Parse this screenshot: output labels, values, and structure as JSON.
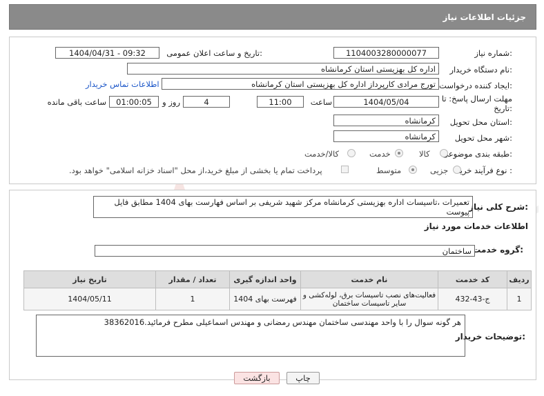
{
  "header": {
    "title": "جزئیات اطلاعات نیاز"
  },
  "form": {
    "need_number_label": "شماره نیاز:",
    "need_number": "1104003280000077",
    "announce_label": "تاریخ و ساعت اعلان عمومی:",
    "announce_value": "1404/04/31 - 09:32",
    "buyer_label": "نام دستگاه خریدار:",
    "buyer_value": "اداره کل بهزیستی استان کرمانشاه",
    "creator_label": "ایجاد کننده درخواست:",
    "creator_value": "تورج مرادی کارپرداز  اداره کل بهزیستی استان کرمانشاه",
    "contact_link": "اطلاعات تماس خریدار",
    "deadline_label_1": "مهلت ارسال پاسخ: تا",
    "deadline_label_2": "تاریخ:",
    "deadline_date": "1404/05/04",
    "time_label": "ساعت",
    "deadline_time": "11:00",
    "days_value": "4",
    "days_label": "روز و",
    "remaining_value": "01:00:05",
    "remaining_label": "ساعت باقی مانده",
    "province_label": "استان محل تحویل:",
    "province_value": "کرمانشاه",
    "city_label": "شهر محل تحویل:",
    "city_value": "کرمانشاه",
    "category_label": "طبقه بندی موضوعی:",
    "category_options": [
      "کالا",
      "خدمت",
      "کالا/خدمت"
    ],
    "category_selected": "خدمت",
    "process_label": "نوع فرآیند خرید :",
    "process_options": [
      "جزیی",
      "متوسط"
    ],
    "process_selected": "متوسط",
    "payment_note": "پرداخت تمام یا بخشی از مبلغ خرید،از محل \"اسناد خزانه اسلامی\" خواهد بود."
  },
  "description": {
    "label": "شرح کلی نیاز:",
    "value": "تعمیرات ،تاسیسات اداره بهزیستی کرمانشاه مرکز شهید شریفی  بر اساس فهارست بهای 1404 مطابق فایل پیوست"
  },
  "services": {
    "section_title": "اطلاعات خدمات مورد نیاز",
    "group_label": "گروه خدمت:",
    "group_value": "ساختمان",
    "columns": [
      "ردیف",
      "کد خدمت",
      "نام خدمت",
      "واحد اندازه گیری",
      "تعداد / مقدار",
      "تاریخ نیاز"
    ],
    "rows": [
      [
        "1",
        "ج-43-432",
        "فعالیت‌های نصب تاسیسات برق، لوله‌کشی و سایر تاسیسات ساختمان",
        "فهرست بهای 1404",
        "1",
        "1404/05/11"
      ]
    ]
  },
  "buyer_notes": {
    "label": "توضیحات خریدار:",
    "value": "هر گونه سوال را با واحد مهندسی ساختمان مهندس رمضانی و مهندس اسماعیلی مطرح فرمائید.38362016"
  },
  "buttons": {
    "print": "چاپ",
    "back": "بازگشت"
  },
  "watermark": {
    "text": "AriaTender.net"
  }
}
